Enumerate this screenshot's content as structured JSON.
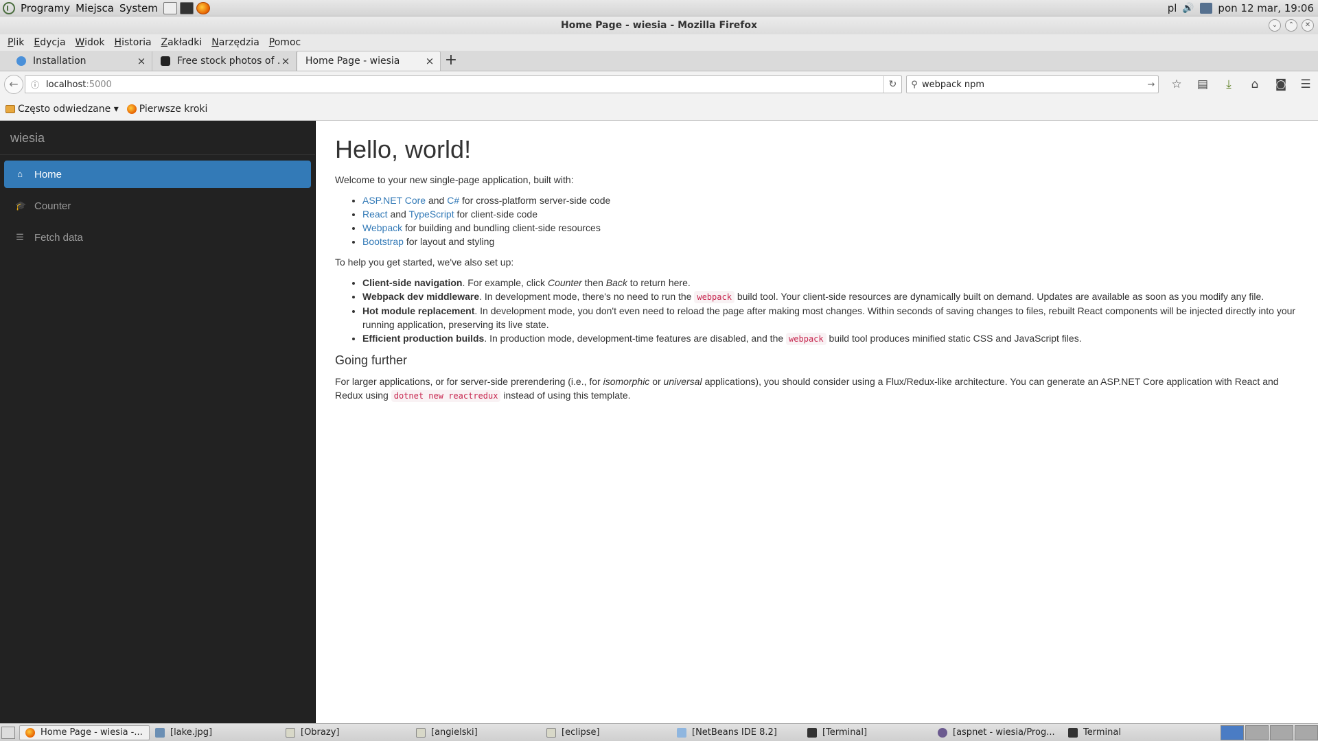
{
  "top_panel": {
    "menus": [
      "Programy",
      "Miejsca",
      "System"
    ],
    "keyboard_layout": "pl",
    "clock": "pon 12 mar, 19:06"
  },
  "window": {
    "title": "Home Page - wiesia - Mozilla Firefox"
  },
  "menubar": {
    "items": [
      {
        "u": "P",
        "rest": "lik"
      },
      {
        "u": "E",
        "rest": "dycja"
      },
      {
        "u": "W",
        "rest": "idok"
      },
      {
        "u": "H",
        "rest": "istoria"
      },
      {
        "u": "Z",
        "rest": "akładki"
      },
      {
        "u": "N",
        "rest": "arzędzia"
      },
      {
        "u": "P",
        "rest": "omoc"
      }
    ]
  },
  "tabs": [
    {
      "label": "Installation",
      "favicon_color": "#4a90d9"
    },
    {
      "label": "Free stock photos of ...",
      "favicon_color": "#222222"
    },
    {
      "label": "Home Page - wiesia",
      "favicon_color": "none"
    }
  ],
  "navbar": {
    "url_host": "localhost",
    "url_port": ":5000",
    "search_value": "webpack npm"
  },
  "bookmarks": [
    {
      "label": "Często odwiedzane ▾",
      "icon": "folder-icon"
    },
    {
      "label": "Pierwsze kroki",
      "icon": "firefox-icon"
    }
  ],
  "app": {
    "brand": "wiesia",
    "nav": [
      {
        "label": "Home",
        "icon": "home-icon",
        "active": true
      },
      {
        "label": "Counter",
        "icon": "education-icon",
        "active": false
      },
      {
        "label": "Fetch data",
        "icon": "list-icon",
        "active": false
      }
    ]
  },
  "content": {
    "heading": "Hello, world!",
    "intro": "Welcome to your new single-page application, built with:",
    "built_with": [
      {
        "link1": "ASP.NET Core",
        "and": " and ",
        "link2": "C#",
        "rest": " for cross-platform server-side code"
      },
      {
        "link1": "React",
        "and": " and ",
        "link2": "TypeScript",
        "rest": " for client-side code"
      },
      {
        "link1": "Webpack",
        "rest": " for building and bundling client-side resources"
      },
      {
        "link1": "Bootstrap",
        "rest": " for layout and styling"
      }
    ],
    "help_intro": "To help you get started, we've also set up:",
    "features": [
      {
        "title": "Client-side navigation",
        "p1": ". For example, click ",
        "em1": "Counter",
        "p2": " then ",
        "em2": "Back",
        "p3": " to return here."
      },
      {
        "title": "Webpack dev middleware",
        "p1": ". In development mode, there's no need to run the ",
        "code": "webpack",
        "p2": " build tool. Your client-side resources are dynamically built on demand. Updates are available as soon as you modify any file."
      },
      {
        "title": "Hot module replacement",
        "p1": ". In development mode, you don't even need to reload the page after making most changes. Within seconds of saving changes to files, rebuilt React components will be injected directly into your running application, preserving its live state."
      },
      {
        "title": "Efficient production builds",
        "p1": ". In production mode, development-time features are disabled, and the ",
        "code": "webpack",
        "p2": " build tool produces minified static CSS and JavaScript files."
      }
    ],
    "further_heading": "Going further",
    "further": {
      "p1": "For larger applications, or for server-side prerendering (i.e., for ",
      "em1": "isomorphic",
      "p2": " or ",
      "em2": "universal",
      "p3": " applications), you should consider using a Flux/Redux-like architecture. You can generate an ASP.NET Core application with React and Redux using ",
      "code": "dotnet new reactredux",
      "p4": " instead of using this template."
    }
  },
  "taskbar": {
    "tasks": [
      {
        "label": "Home Page - wiesia -...",
        "icon": "firefox-icon",
        "active": true
      },
      {
        "label": "[lake.jpg]",
        "icon": "image-icon",
        "active": false
      },
      {
        "label": "[Obrazy]",
        "icon": "folder-icon",
        "active": false
      },
      {
        "label": "[angielski]",
        "icon": "folder-icon",
        "active": false
      },
      {
        "label": "[eclipse]",
        "icon": "folder-icon",
        "active": false
      },
      {
        "label": "[NetBeans IDE 8.2]",
        "icon": "netbeans-icon",
        "active": false
      },
      {
        "label": "[Terminal]",
        "icon": "terminal-icon",
        "active": false
      },
      {
        "label": "[aspnet - wiesia/Prog...",
        "icon": "eclipse-icon",
        "active": false
      },
      {
        "label": "Terminal",
        "icon": "terminal-icon",
        "active": false
      }
    ]
  },
  "colors": {
    "sidebar_bg": "#222222",
    "active_nav": "#337ab7",
    "link": "#337ab7",
    "code": "#c7254e"
  }
}
